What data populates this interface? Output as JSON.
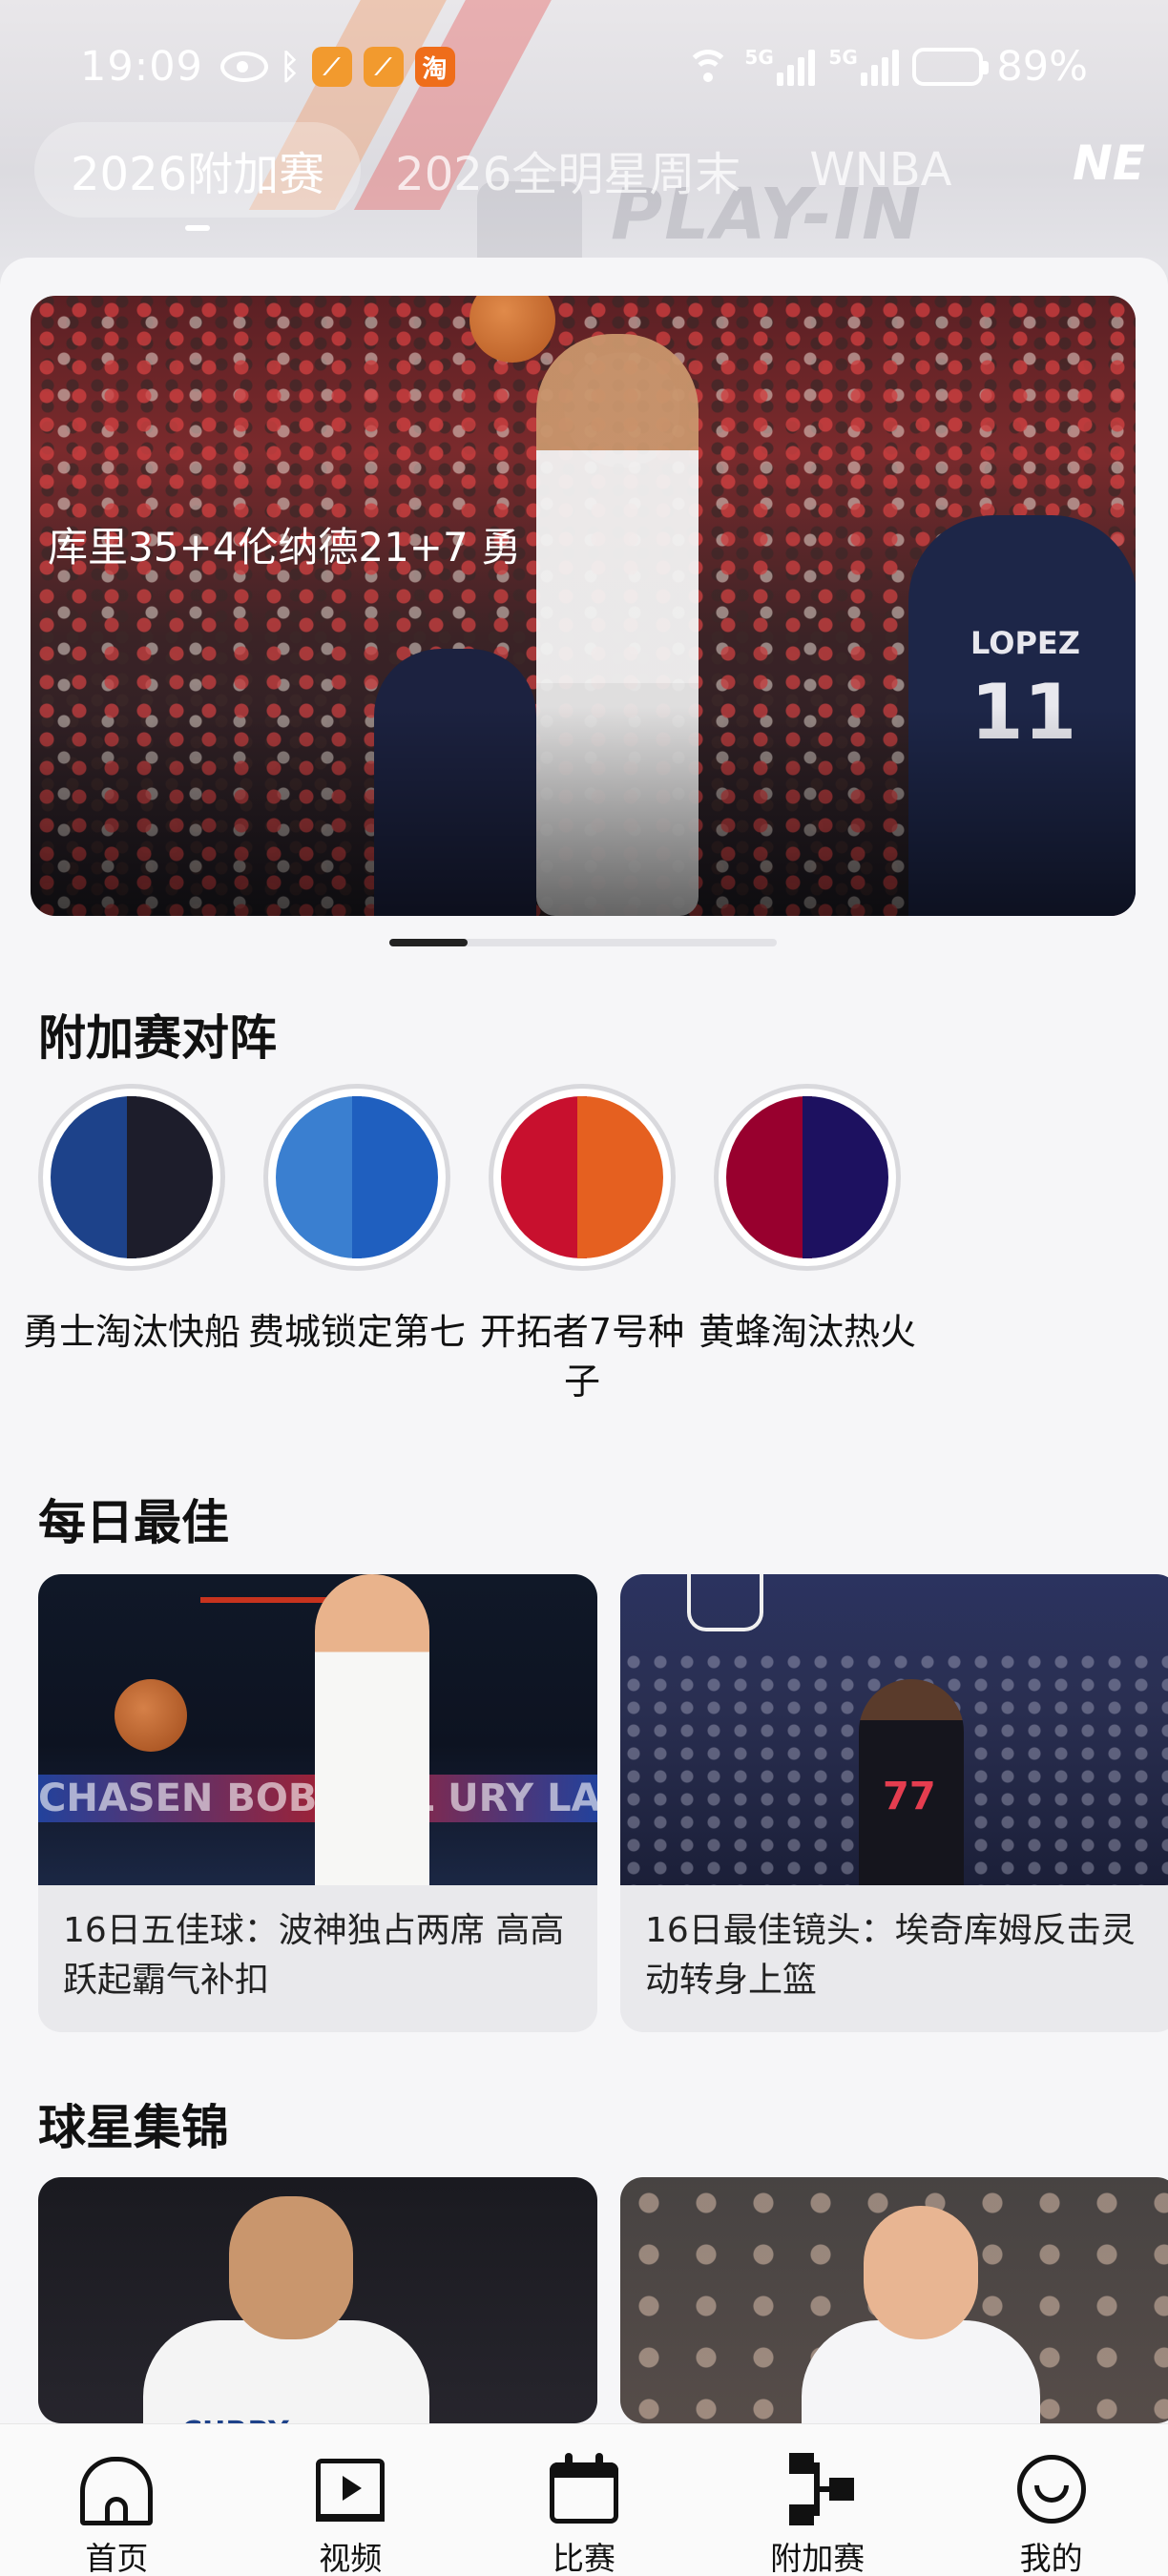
{
  "status_bar": {
    "time": "19:09",
    "app_badges": [
      "orange-app-icon",
      "orange-app-icon",
      "淘"
    ],
    "network_labels": [
      "5G",
      "5G"
    ],
    "battery_percent": "89%",
    "battery_level": 0.89
  },
  "top_tabs": [
    {
      "label": "2026附加赛",
      "active": true
    },
    {
      "label": "2026全明星周末",
      "active": false
    },
    {
      "label": "WNBA",
      "active": false
    }
  ],
  "header_logo_text": "NE",
  "hero": {
    "caption": "库里35+4伦纳德21+7 勇",
    "jersey_name": "LOPEZ",
    "jersey_number": "11",
    "carousel_position": 0.2
  },
  "sections": {
    "matchups_title": "附加赛对阵",
    "daily_best_title": "每日最佳",
    "star_highlights_title": "球星集锦"
  },
  "matchups": [
    {
      "label": "勇士淘汰快船",
      "colors": [
        "#1d428a",
        "#1d1d2b"
      ]
    },
    {
      "label": "费城锁定第七",
      "colors": [
        "#3a7fd0",
        "#1f5fbf"
      ]
    },
    {
      "label": "开拓者7号种子",
      "colors": [
        "#c8102e",
        "#e56020"
      ]
    },
    {
      "label": "黄蜂淘汰热火",
      "colors": [
        "#98002e",
        "#1d1160"
      ]
    }
  ],
  "daily_best": [
    {
      "title": "16日五佳球：波神独占两席 高高跃起霸气补扣",
      "banner_text": "CHASEN BOBCOOL URY LAV"
    },
    {
      "title": "16日最佳镜头：埃奇库姆反击灵动转身上篮",
      "jersey_number": "77"
    }
  ],
  "star_highlights": [
    {
      "jersey_name": "CURRY"
    },
    {
      "jersey_name": ""
    }
  ],
  "bottom_nav": [
    {
      "label": "首页",
      "icon": "home-icon"
    },
    {
      "label": "视频",
      "icon": "video-icon"
    },
    {
      "label": "比赛",
      "icon": "calendar-icon"
    },
    {
      "label": "附加赛",
      "icon": "bracket-icon"
    },
    {
      "label": "我的",
      "icon": "profile-icon"
    }
  ]
}
